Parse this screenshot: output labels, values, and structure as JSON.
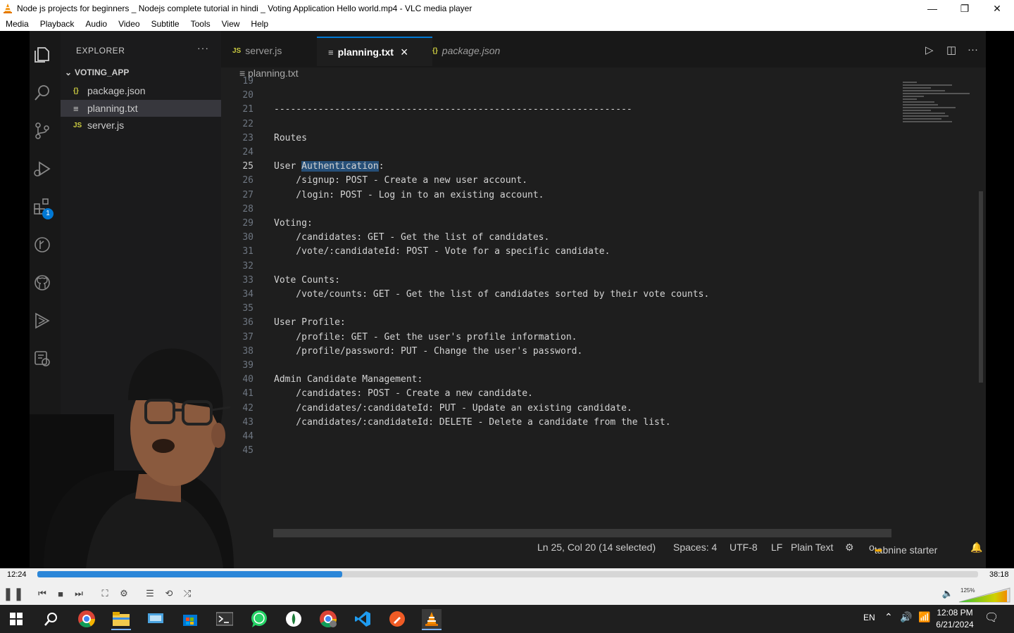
{
  "window": {
    "title": "Node js projects for beginners _ Nodejs complete tutorial in hindi _ Voting Application Hello world.mp4 - VLC media player"
  },
  "menu": [
    "Media",
    "Playback",
    "Audio",
    "Video",
    "Subtitle",
    "Tools",
    "View",
    "Help"
  ],
  "vscode": {
    "explorer": {
      "title": "EXPLORER",
      "more": "···",
      "folder": "VOTING_APP",
      "files": [
        {
          "icon": "{}",
          "name": "package.json"
        },
        {
          "icon": "≡",
          "name": "planning.txt"
        },
        {
          "icon": "JS",
          "name": "server.js"
        }
      ]
    },
    "tabs": [
      {
        "icon": "JS",
        "label": "server.js"
      },
      {
        "icon": "≡",
        "label": "planning.txt",
        "close": "×"
      },
      {
        "icon": "{}",
        "label": "package.json"
      }
    ],
    "breadcrumb": "≡ planning.txt",
    "badge": "1",
    "code_lines": [
      {
        "n": "19",
        "text": ""
      },
      {
        "n": "20",
        "text": ""
      },
      {
        "n": "21",
        "text": "-----------------------------------------------------------------"
      },
      {
        "n": "22",
        "text": ""
      },
      {
        "n": "23",
        "text": "Routes"
      },
      {
        "n": "24",
        "text": ""
      },
      {
        "n": "25",
        "pre": "User ",
        "sel": "Authentication",
        "post": ":"
      },
      {
        "n": "26",
        "text": "    /signup: POST - Create a new user account."
      },
      {
        "n": "27",
        "text": "    /login: POST - Log in to an existing account."
      },
      {
        "n": "28",
        "text": ""
      },
      {
        "n": "29",
        "text": "Voting:"
      },
      {
        "n": "30",
        "text": "    /candidates: GET - Get the list of candidates."
      },
      {
        "n": "31",
        "text": "    /vote/:candidateId: POST - Vote for a specific candidate."
      },
      {
        "n": "32",
        "text": ""
      },
      {
        "n": "33",
        "text": "Vote Counts:"
      },
      {
        "n": "34",
        "text": "    /vote/counts: GET - Get the list of candidates sorted by their vote counts."
      },
      {
        "n": "35",
        "text": ""
      },
      {
        "n": "36",
        "text": "User Profile:"
      },
      {
        "n": "37",
        "text": "    /profile: GET - Get the user's profile information."
      },
      {
        "n": "38",
        "text": "    /profile/password: PUT - Change the user's password."
      },
      {
        "n": "39",
        "text": ""
      },
      {
        "n": "40",
        "text": "Admin Candidate Management:"
      },
      {
        "n": "41",
        "text": "    /candidates: POST - Create a new candidate."
      },
      {
        "n": "42",
        "text": "    /candidates/:candidateId: PUT - Update an existing candidate."
      },
      {
        "n": "43",
        "text": "    /candidates/:candidateId: DELETE - Delete a candidate from the list."
      },
      {
        "n": "44",
        "text": ""
      },
      {
        "n": "45",
        "text": ""
      }
    ],
    "status": {
      "position": "Ln 25, Col 20 (14 selected)",
      "spaces": "Spaces: 4",
      "encoding": "UTF-8",
      "eol": "LF",
      "language": "Plain Text",
      "tabnine": "tabnine starter"
    }
  },
  "player": {
    "elapsed": "12:24",
    "total": "38:18",
    "progress_fraction": 0.324,
    "volume": "125%"
  },
  "taskbar": {
    "lang": "EN",
    "time": "12:08 PM",
    "date": "6/21/2024"
  },
  "colors": {
    "accent": "#0078d4",
    "selection": "#264f78",
    "seek": "#2b86d8",
    "vlc_orange": "#f28c00"
  }
}
